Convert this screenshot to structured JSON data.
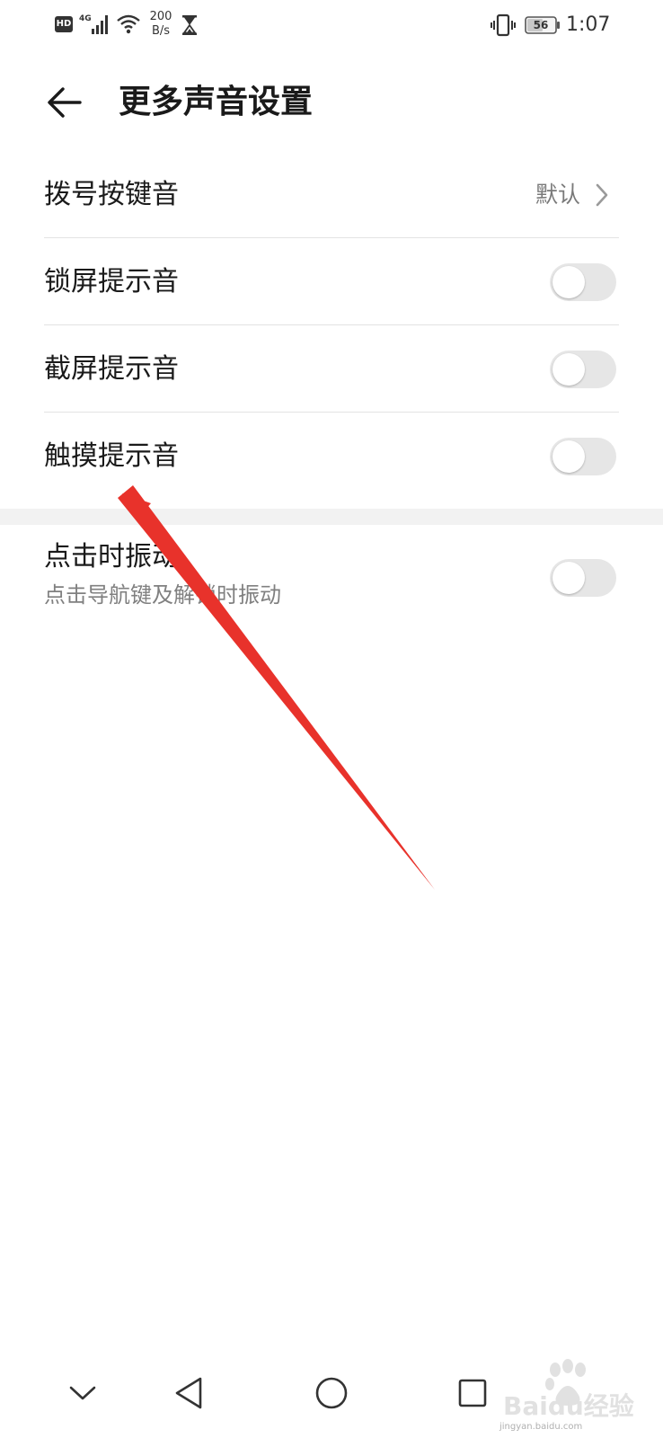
{
  "status_bar": {
    "hd": "HD",
    "network": "4G",
    "speed_value": "200",
    "speed_unit": "B/s",
    "battery": "56",
    "time": "1:07"
  },
  "header": {
    "title": "更多声音设置"
  },
  "settings": {
    "dial_pad": {
      "label": "拨号按键音",
      "value": "默认"
    },
    "lock_screen": {
      "label": "锁屏提示音",
      "enabled": false
    },
    "screenshot": {
      "label": "截屏提示音",
      "enabled": false
    },
    "touch": {
      "label": "触摸提示音",
      "enabled": false
    },
    "vibrate_on_tap": {
      "label": "点击时振动",
      "description": "点击导航键及解锁时振动",
      "enabled": false
    }
  },
  "watermark": {
    "brand": "Baidu经验",
    "url": "jingyan.baidu.com"
  },
  "colors": {
    "annotation_arrow": "#e8322b",
    "toggle_off_track": "#e6e6e6",
    "divider": "#e3e3e3",
    "section_gap": "#f2f2f2",
    "secondary_text": "#808080"
  },
  "icons": {
    "back": "arrow-left-icon",
    "chevron": "chevron-right-icon",
    "nav_down": "chevron-down-icon",
    "nav_back": "triangle-back-icon",
    "nav_home": "circle-home-icon",
    "nav_recent": "square-recent-icon"
  }
}
